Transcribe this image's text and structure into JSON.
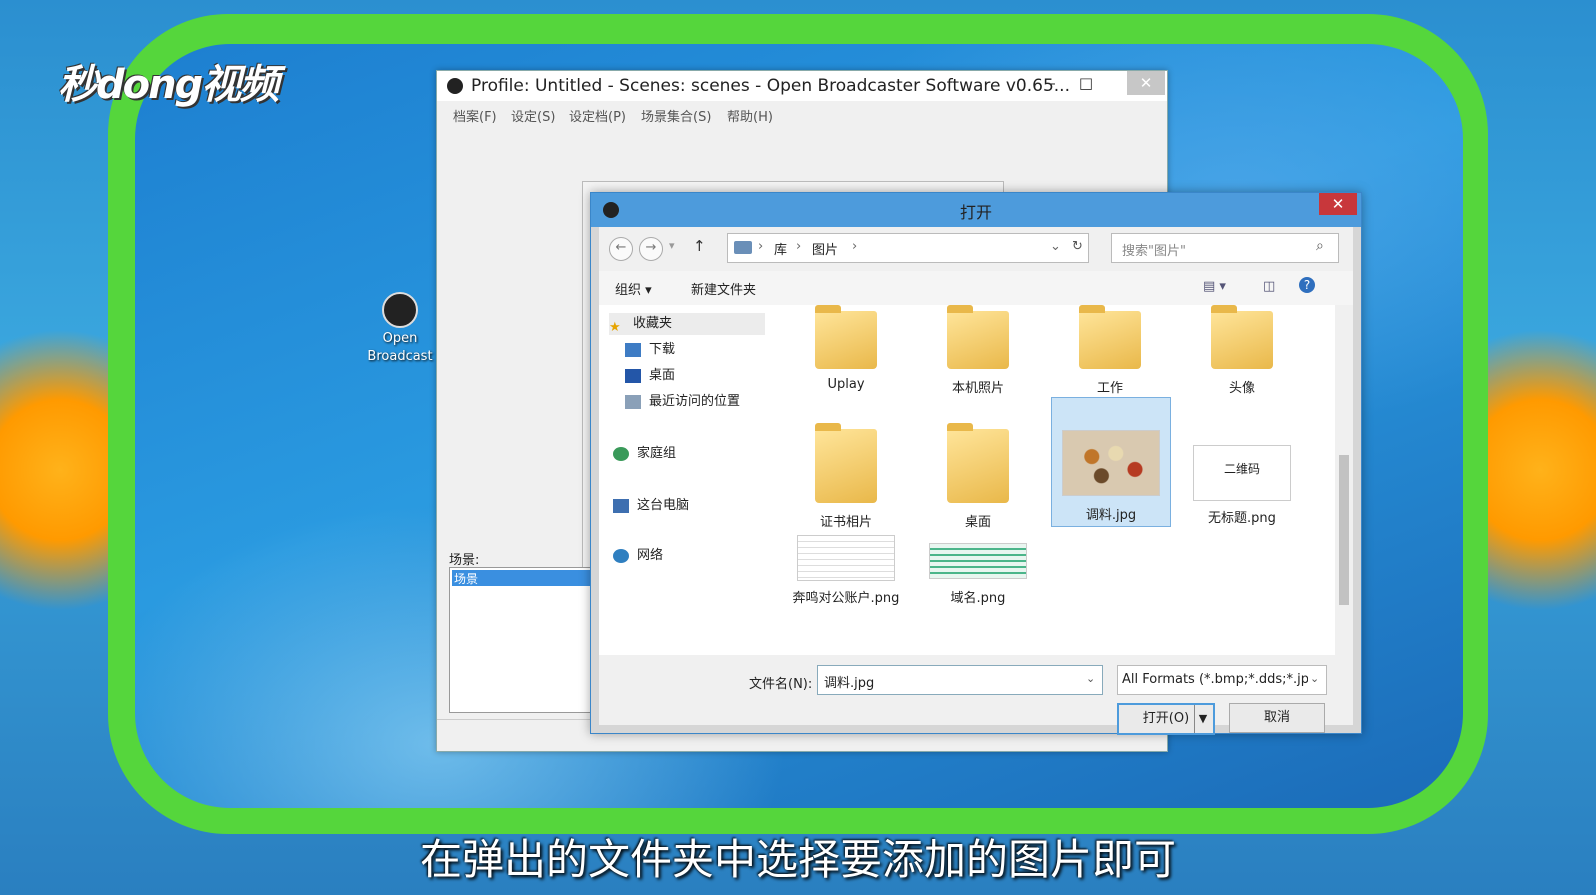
{
  "watermark": "秒dong视频",
  "desktop_icon": {
    "label_line1": "Open",
    "label_line2": "Broadcast"
  },
  "obs": {
    "title": "Profile: Untitled - Scenes: scenes - Open Broadcaster Software v0.65...",
    "menu": [
      "档案(F)",
      "设定(S)",
      "设定档(P)",
      "场景集合(S)",
      "帮助(H)"
    ],
    "scene_label": "场景:",
    "scene_item": "场景"
  },
  "dialog": {
    "title": "打开",
    "breadcrumb": [
      "库",
      "图片"
    ],
    "search_placeholder": "搜索\"图片\"",
    "toolbar": {
      "organize": "组织 ▾",
      "new_folder": "新建文件夹"
    },
    "nav": {
      "favorites": "收藏夹",
      "downloads": "下载",
      "desktop": "桌面",
      "recent": "最近访问的位置",
      "homegroup": "家庭组",
      "this_pc": "这台电脑",
      "network": "网络"
    },
    "files": [
      {
        "name": "Uplay",
        "kind": "folder"
      },
      {
        "name": "本机照片",
        "kind": "folder"
      },
      {
        "name": "工作",
        "kind": "folder"
      },
      {
        "name": "头像",
        "kind": "folder"
      },
      {
        "name": "证书相片",
        "kind": "folder"
      },
      {
        "name": "桌面",
        "kind": "folder"
      },
      {
        "name": "调料.jpg",
        "kind": "image"
      },
      {
        "name": "无标题.png",
        "kind": "image",
        "thumb_text": "二维码"
      },
      {
        "name": "奔鸣对公账户.png",
        "kind": "image"
      },
      {
        "name": "域名.png",
        "kind": "image"
      }
    ],
    "filename_label": "文件名(N):",
    "filename_value": "调料.jpg",
    "format_value": "All Formats (*.bmp;*.dds;*.jp",
    "open_button": "打开(O)",
    "cancel_button": "取消"
  },
  "subtitle": "在弹出的文件夹中选择要添加的图片即可",
  "colors": {
    "frame": "#55d63c",
    "dialog_title": "#4d9bdc",
    "close": "#c8373b",
    "selection": "#cce4f7"
  }
}
